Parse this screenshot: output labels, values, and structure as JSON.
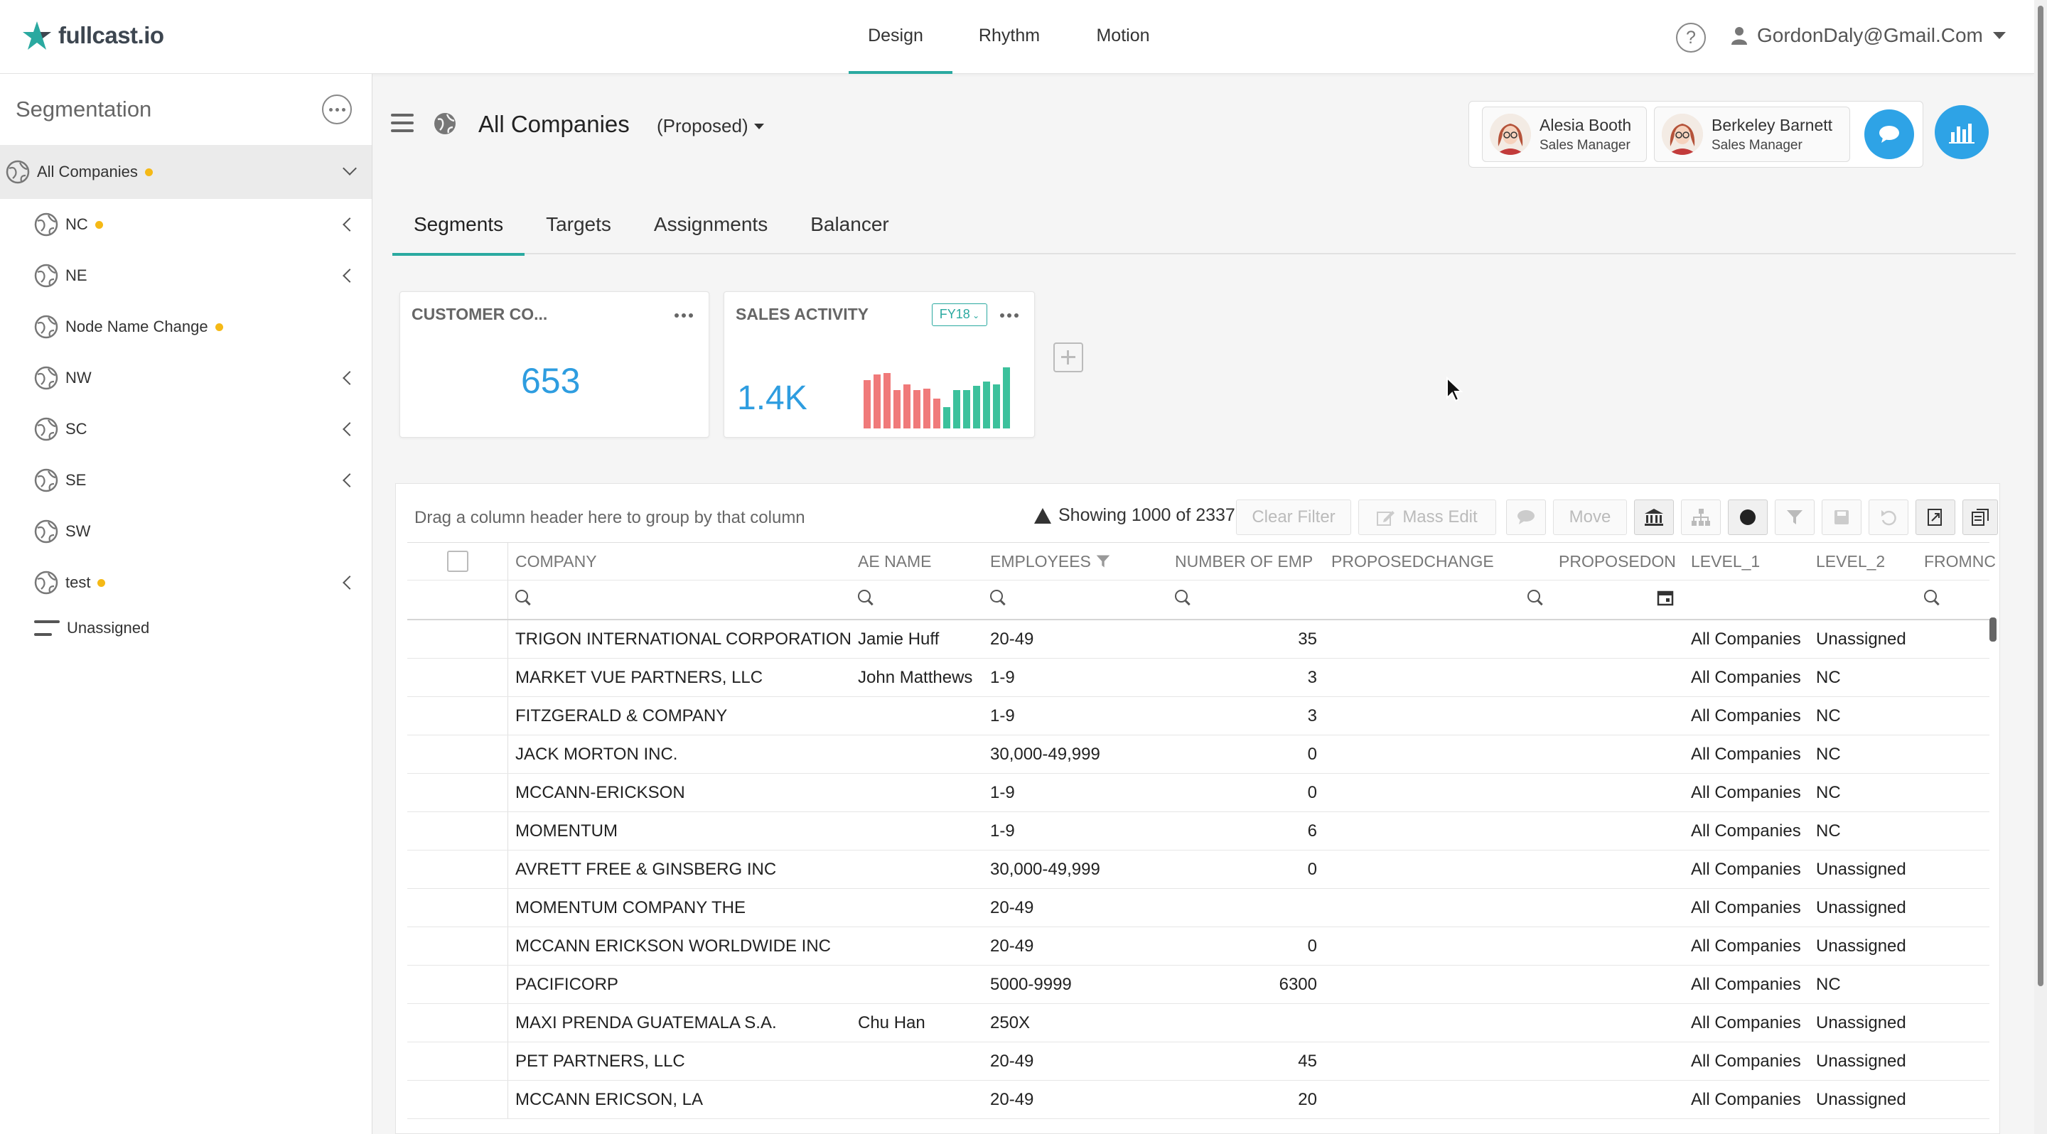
{
  "app": {
    "logo": "fullcast.io"
  },
  "top_nav": [
    {
      "label": "Design",
      "active": true
    },
    {
      "label": "Rhythm",
      "active": false
    },
    {
      "label": "Motion",
      "active": false
    }
  ],
  "user": {
    "help": "?",
    "email": "GordonDaly@Gmail.Com"
  },
  "sidebar": {
    "title": "Segmentation",
    "root": {
      "label": "All Companies",
      "has_dot": true
    },
    "items": [
      {
        "label": "NC",
        "dot": true,
        "chevron": true
      },
      {
        "label": "NE",
        "dot": false,
        "chevron": true
      },
      {
        "label": "Node Name Change",
        "dot": true,
        "chevron": false
      },
      {
        "label": "NW",
        "dot": false,
        "chevron": true
      },
      {
        "label": "SC",
        "dot": false,
        "chevron": true
      },
      {
        "label": "SE",
        "dot": false,
        "chevron": true
      },
      {
        "label": "SW",
        "dot": false,
        "chevron": false
      },
      {
        "label": "test",
        "dot": true,
        "chevron": true
      }
    ],
    "unassigned": "Unassigned"
  },
  "header": {
    "title": "All Companies",
    "subtitle": "(Proposed)"
  },
  "managers": [
    {
      "name": "Alesia Booth",
      "role": "Sales Manager"
    },
    {
      "name": "Berkeley Barnett",
      "role": "Sales Manager"
    }
  ],
  "tabs": [
    {
      "label": "Segments",
      "active": true
    },
    {
      "label": "Targets",
      "active": false
    },
    {
      "label": "Assignments",
      "active": false
    },
    {
      "label": "Balancer",
      "active": false
    }
  ],
  "cards": {
    "customer": {
      "title": "CUSTOMER CO...",
      "value": "653"
    },
    "sales": {
      "title": "SALES ACTIVITY",
      "period": "FY18",
      "value": "1.4K"
    }
  },
  "colors": {
    "accent": "#2aa9a0",
    "primary": "#2e9de0",
    "dot": "#f5b916",
    "bar_red": "#f07a7a",
    "bar_green": "#3cc19c"
  },
  "grid": {
    "group_hint": "Drag a column header here to group by that column",
    "showing": "Showing 1000 of 2337",
    "buttons": {
      "clear_filter": "Clear Filter",
      "mass_edit": "Mass Edit",
      "move": "Move"
    },
    "columns": [
      "COMPANY",
      "AE NAME",
      "EMPLOYEES",
      "NUMBER OF EMP",
      "PROPOSEDCHANGE",
      "PROPOSEDON",
      "LEVEL_1",
      "LEVEL_2",
      "FROMNC"
    ],
    "rows": [
      [
        "TRIGON INTERNATIONAL CORPORATION",
        "Jamie Huff",
        "20-49",
        "35",
        "",
        "",
        "All Companies",
        "Unassigned"
      ],
      [
        "MARKET VUE PARTNERS, LLC",
        "John Matthews",
        "1-9",
        "3",
        "",
        "",
        "All Companies",
        "NC"
      ],
      [
        "FITZGERALD & COMPANY",
        "",
        "1-9",
        "3",
        "",
        "",
        "All Companies",
        "NC"
      ],
      [
        "JACK MORTON INC.",
        "",
        "30,000-49,999",
        "0",
        "",
        "",
        "All Companies",
        "NC"
      ],
      [
        "MCCANN-ERICKSON",
        "",
        "1-9",
        "0",
        "",
        "",
        "All Companies",
        "NC"
      ],
      [
        "MOMENTUM",
        "",
        "1-9",
        "6",
        "",
        "",
        "All Companies",
        "NC"
      ],
      [
        "AVRETT FREE & GINSBERG INC",
        "",
        "30,000-49,999",
        "0",
        "",
        "",
        "All Companies",
        "Unassigned"
      ],
      [
        "MOMENTUM COMPANY THE",
        "",
        "20-49",
        "",
        "",
        "",
        "All Companies",
        "Unassigned"
      ],
      [
        "MCCANN ERICKSON WORLDWIDE INC",
        "",
        "20-49",
        "0",
        "",
        "",
        "All Companies",
        "Unassigned"
      ],
      [
        "PACIFICORP",
        "",
        "5000-9999",
        "6300",
        "",
        "",
        "All Companies",
        "NC"
      ],
      [
        "MAXI PRENDA GUATEMALA S.A.",
        "Chu Han",
        "250X",
        "",
        "",
        "",
        "All Companies",
        "Unassigned"
      ],
      [
        "PET PARTNERS, LLC",
        "",
        "20-49",
        "45",
        "",
        "",
        "All Companies",
        "Unassigned"
      ],
      [
        "MCCANN ERICSON, LA",
        "",
        "20-49",
        "20",
        "",
        "",
        "All Companies",
        "Unassigned"
      ]
    ]
  }
}
